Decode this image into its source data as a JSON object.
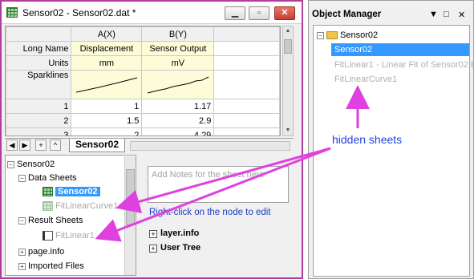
{
  "workbook": {
    "title": "Sensor02 - Sensor02.dat *",
    "controls": {
      "minimize": "▁",
      "restore": "▫",
      "close": "✕"
    },
    "columns": [
      "A(X)",
      "B(Y)"
    ],
    "meta_rows": [
      {
        "label": "Long Name",
        "values": [
          "Displacement",
          "Sensor Output"
        ]
      },
      {
        "label": "Units",
        "values": [
          "mm",
          "mV"
        ]
      }
    ],
    "sparklines_label": "Sparklines",
    "data_rows": [
      {
        "index": "1",
        "values": [
          "1",
          "1.17"
        ]
      },
      {
        "index": "2",
        "values": [
          "1.5",
          "2.9"
        ]
      },
      {
        "index": "3",
        "values": [
          "2",
          "4.29"
        ]
      }
    ],
    "nav_buttons": [
      "◀",
      "▶",
      "+",
      "^"
    ],
    "active_sheet": "Sensor02",
    "organizer": {
      "root": "Sensor02",
      "data_sheets_label": "Data Sheets",
      "data_sheets": [
        "Sensor02",
        "FitLinearCurve1"
      ],
      "result_sheets_label": "Result Sheets",
      "result_sheets": [
        "FitLinear1"
      ],
      "page_info": "page.info",
      "imported_files": "Imported Files"
    },
    "notes_placeholder": "Add Notes for the sheet here",
    "hint": "Right-click on the node to edit",
    "properties": [
      "layer.info",
      "User Tree"
    ]
  },
  "object_manager": {
    "title": "Object Manager",
    "root": "Sensor02",
    "items": [
      "Sensor02",
      "FitLinear1 - Linear Fit of Sensor02 B",
      "FitLinearCurve1"
    ]
  },
  "annotation": "hidden sheets",
  "colors": {
    "accent": "#b03c9b",
    "selection": "#3399ff",
    "arrow": "#e040e0",
    "annotation_text": "#2244dd"
  }
}
